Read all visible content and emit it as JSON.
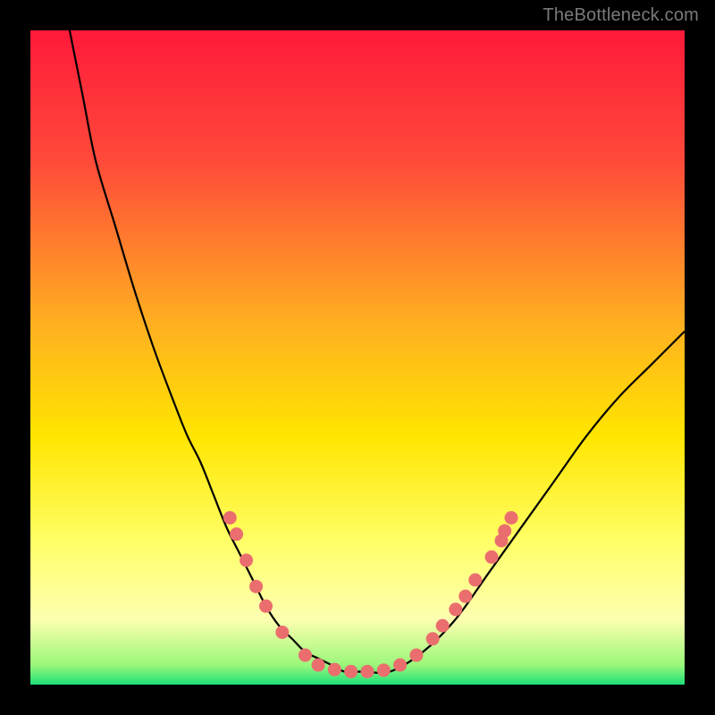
{
  "watermark": "TheBottleneck.com",
  "chart_data": {
    "type": "line",
    "title": "",
    "xlabel": "",
    "ylabel": "",
    "xlim": [
      0,
      100
    ],
    "ylim": [
      0,
      100
    ],
    "grid": false,
    "legend": false,
    "background_gradient": {
      "stops": [
        {
          "offset": 0.0,
          "color": "#ff1a3a"
        },
        {
          "offset": 0.2,
          "color": "#ff4a3a"
        },
        {
          "offset": 0.45,
          "color": "#ffb020"
        },
        {
          "offset": 0.62,
          "color": "#ffe500"
        },
        {
          "offset": 0.78,
          "color": "#ffff66"
        },
        {
          "offset": 0.9,
          "color": "#fdffb0"
        },
        {
          "offset": 0.97,
          "color": "#9bf77a"
        },
        {
          "offset": 1.0,
          "color": "#1ee07a"
        }
      ]
    },
    "series": [
      {
        "name": "bottleneck-curve",
        "x": [
          6,
          8,
          10,
          13,
          16,
          19,
          22,
          24,
          26,
          28,
          30,
          32,
          34,
          36,
          38,
          40,
          42,
          44,
          46,
          48,
          51,
          55,
          60,
          65,
          70,
          75,
          80,
          85,
          90,
          95,
          100
        ],
        "y": [
          100,
          90,
          80,
          70,
          60,
          51,
          43,
          38,
          34,
          29,
          24,
          20,
          16,
          12,
          9,
          7,
          5,
          4,
          3,
          2,
          2,
          2,
          5,
          10,
          17,
          24,
          31,
          38,
          44,
          49,
          54
        ]
      }
    ],
    "markers": [
      {
        "x": 30.5,
        "y": 25.5
      },
      {
        "x": 31.5,
        "y": 23.0
      },
      {
        "x": 33.0,
        "y": 19.0
      },
      {
        "x": 34.5,
        "y": 15.0
      },
      {
        "x": 36.0,
        "y": 12.0
      },
      {
        "x": 38.5,
        "y": 8.0
      },
      {
        "x": 42.0,
        "y": 4.5
      },
      {
        "x": 44.0,
        "y": 3.0
      },
      {
        "x": 46.5,
        "y": 2.3
      },
      {
        "x": 49.0,
        "y": 2.0
      },
      {
        "x": 51.5,
        "y": 2.0
      },
      {
        "x": 54.0,
        "y": 2.2
      },
      {
        "x": 56.5,
        "y": 3.0
      },
      {
        "x": 59.0,
        "y": 4.5
      },
      {
        "x": 61.5,
        "y": 7.0
      },
      {
        "x": 63.0,
        "y": 9.0
      },
      {
        "x": 65.0,
        "y": 11.5
      },
      {
        "x": 66.5,
        "y": 13.5
      },
      {
        "x": 68.0,
        "y": 16.0
      },
      {
        "x": 70.5,
        "y": 19.5
      },
      {
        "x": 72.0,
        "y": 22.0
      },
      {
        "x": 72.5,
        "y": 23.5
      },
      {
        "x": 73.5,
        "y": 25.5
      }
    ],
    "marker_style": {
      "fill": "#eb6e6e",
      "stroke": "none",
      "radius": 7.5
    },
    "line_style": {
      "stroke": "#000000",
      "width": 2.2
    }
  }
}
